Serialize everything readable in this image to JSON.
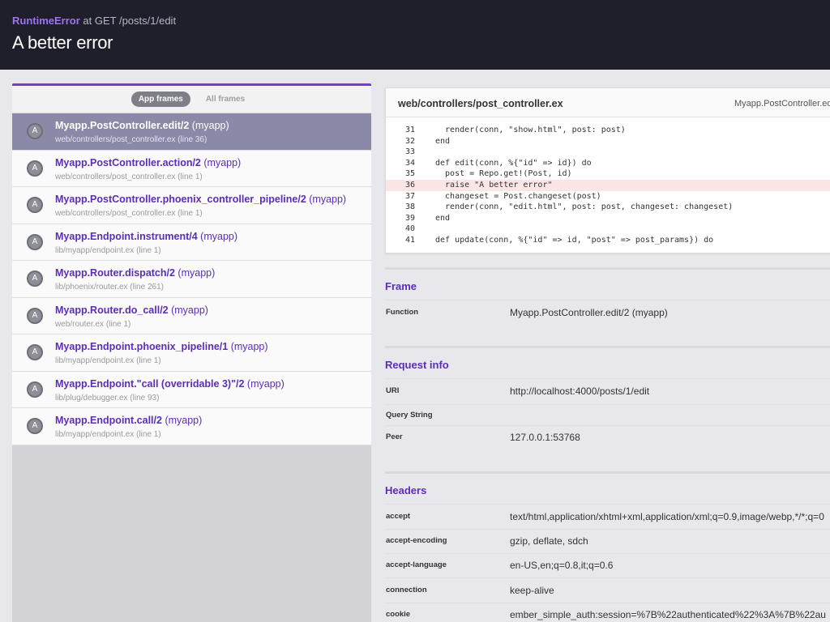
{
  "header": {
    "error_type": "RuntimeError",
    "error_context": " at GET /posts/1/edit",
    "title": "A better error"
  },
  "tabs": [
    {
      "label": "App frames",
      "active": true
    },
    {
      "label": "All frames",
      "active": false
    }
  ],
  "frames": [
    {
      "badge": "A",
      "name": "Myapp.PostController.edit/2",
      "app": " (myapp)",
      "location": "web/controllers/post_controller.ex (line 36)",
      "active": true
    },
    {
      "badge": "A",
      "name": "Myapp.PostController.action/2",
      "app": " (myapp)",
      "location": "web/controllers/post_controller.ex (line 1)"
    },
    {
      "badge": "A",
      "name": "Myapp.PostController.phoenix_controller_pipeline/2",
      "app": " (myapp)",
      "location": "web/controllers/post_controller.ex (line 1)"
    },
    {
      "badge": "A",
      "name": "Myapp.Endpoint.instrument/4",
      "app": " (myapp)",
      "location": "lib/myapp/endpoint.ex (line 1)"
    },
    {
      "badge": "A",
      "name": "Myapp.Router.dispatch/2",
      "app": " (myapp)",
      "location": "lib/phoenix/router.ex (line 261)"
    },
    {
      "badge": "A",
      "name": "Myapp.Router.do_call/2",
      "app": " (myapp)",
      "location": "web/router.ex (line 1)"
    },
    {
      "badge": "A",
      "name": "Myapp.Endpoint.phoenix_pipeline/1",
      "app": " (myapp)",
      "location": "lib/myapp/endpoint.ex (line 1)"
    },
    {
      "badge": "A",
      "name": "Myapp.Endpoint.\"call (overridable 3)\"/2",
      "app": " (myapp)",
      "location": "lib/plug/debugger.ex (line 93)"
    },
    {
      "badge": "A",
      "name": "Myapp.Endpoint.call/2",
      "app": " (myapp)",
      "location": "lib/myapp/endpoint.ex (line 1)"
    }
  ],
  "code": {
    "file": "web/controllers/post_controller.ex",
    "module": "Myapp.PostController.edit/",
    "highlight_line": "36",
    "lines": [
      {
        "n": "31",
        "text": "  render(conn, \"show.html\", post: post)"
      },
      {
        "n": "32",
        "text": "end"
      },
      {
        "n": "33",
        "text": ""
      },
      {
        "n": "34",
        "text": "def edit(conn, %{\"id\" => id}) do"
      },
      {
        "n": "35",
        "text": "  post = Repo.get!(Post, id)"
      },
      {
        "n": "36",
        "text": "  raise \"A better error\""
      },
      {
        "n": "37",
        "text": "  changeset = Post.changeset(post)"
      },
      {
        "n": "38",
        "text": "  render(conn, \"edit.html\", post: post, changeset: changeset)"
      },
      {
        "n": "39",
        "text": "end"
      },
      {
        "n": "40",
        "text": ""
      },
      {
        "n": "41",
        "text": "def update(conn, %{\"id\" => id, \"post\" => post_params}) do"
      }
    ]
  },
  "frame_section": {
    "title": "Frame",
    "rows": [
      {
        "key": "Function",
        "value": "Myapp.PostController.edit/2 (myapp)"
      }
    ]
  },
  "request_section": {
    "title": "Request info",
    "rows": [
      {
        "key": "URI",
        "value": "http://localhost:4000/posts/1/edit"
      },
      {
        "key": "Query String",
        "value": ""
      },
      {
        "key": "Peer",
        "value": "127.0.0.1:53768"
      }
    ]
  },
  "headers_section": {
    "title": "Headers",
    "rows": [
      {
        "key": "accept",
        "value": "text/html,application/xhtml+xml,application/xml;q=0.9,image/webp,*/*;q=0"
      },
      {
        "key": "accept-encoding",
        "value": "gzip, deflate, sdch"
      },
      {
        "key": "accept-language",
        "value": "en-US,en;q=0.8,it;q=0.6"
      },
      {
        "key": "connection",
        "value": "keep-alive"
      },
      {
        "key": "cookie",
        "value": "ember_simple_auth:session=%7B%22authenticated%22%3A%7B%22au"
      }
    ]
  }
}
